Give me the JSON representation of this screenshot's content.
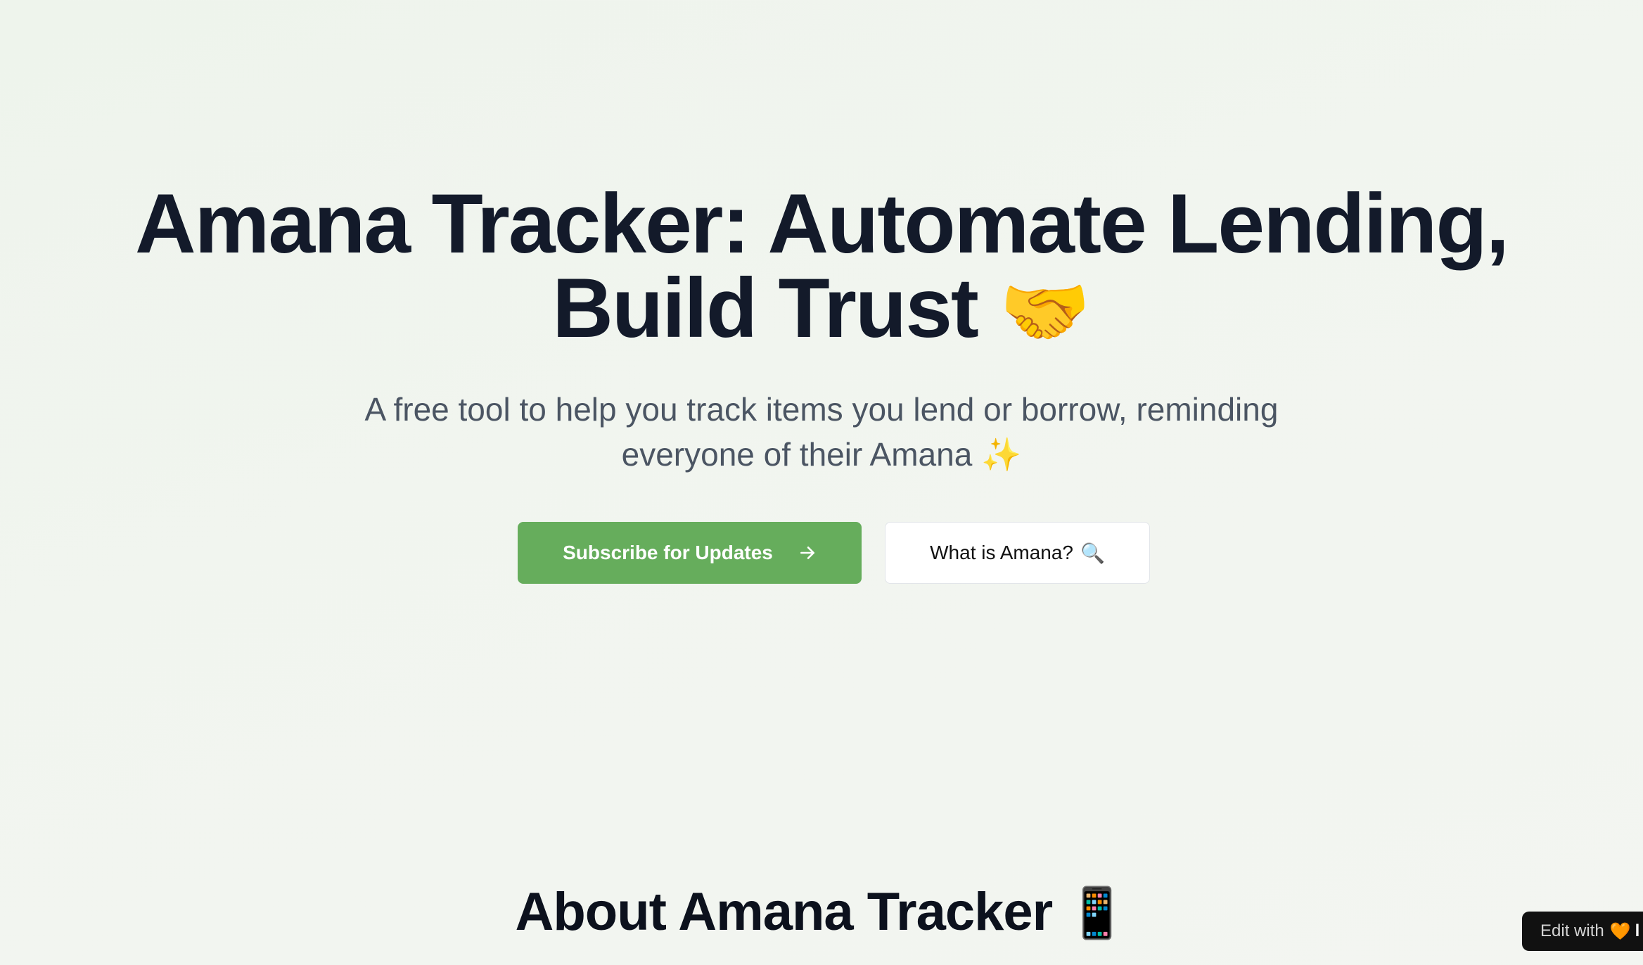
{
  "hero": {
    "title_text": "Amana Tracker: Automate Lending, Build Trust",
    "title_emoji": "🤝",
    "subtitle_text": "A free tool to help you track items you lend or borrow, reminding everyone of their Amana",
    "subtitle_emoji": "✨"
  },
  "cta": {
    "primary_label": "Subscribe for Updates",
    "primary_icon": "arrow-right-icon",
    "secondary_label": "What is Amana?",
    "secondary_emoji": "🔍"
  },
  "about": {
    "title_text": "About Amana Tracker",
    "title_emoji": "📱"
  },
  "edit_badge": {
    "label": "Edit with",
    "heart_emoji": "🧡",
    "brand_partial": "l"
  },
  "colors": {
    "primary_button": "#66ad5c",
    "title_text": "#131a2a",
    "subtitle_text": "#4b5563",
    "background": "#f1f5ef",
    "badge_bg": "#111111"
  }
}
